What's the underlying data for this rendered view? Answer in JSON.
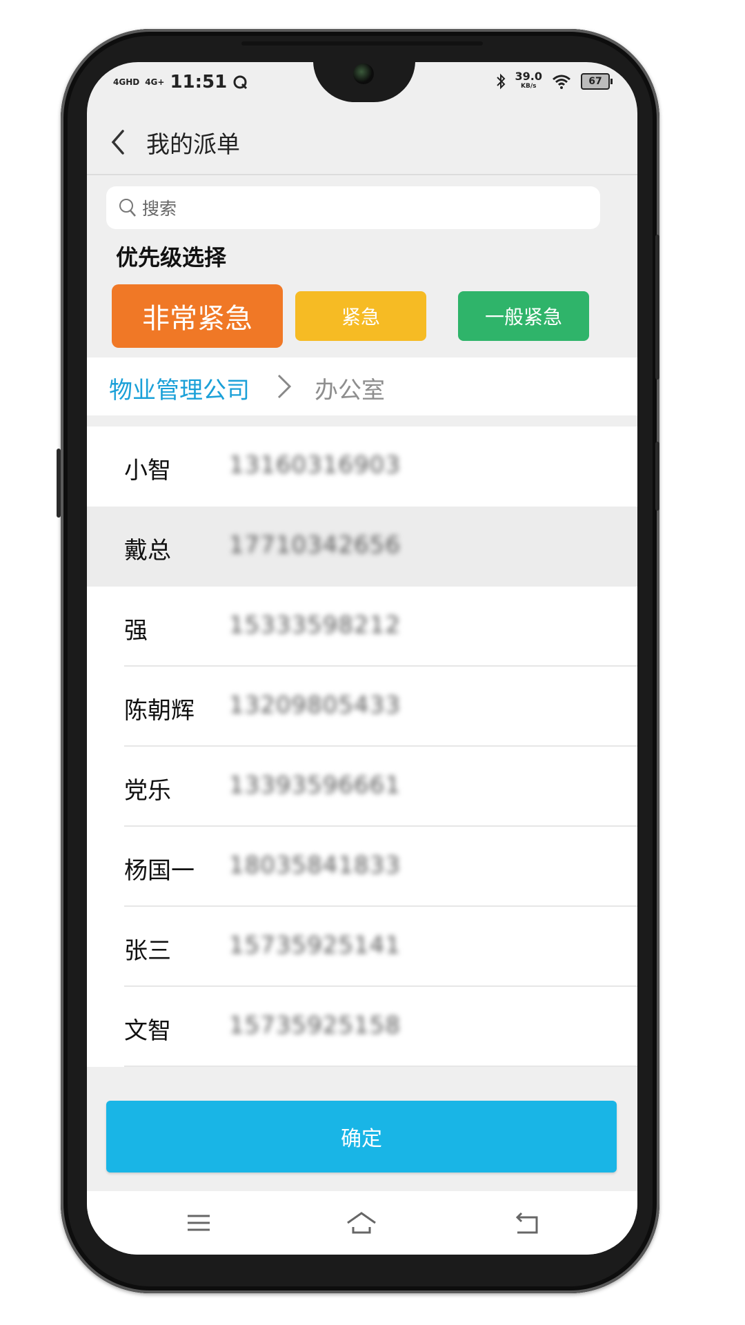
{
  "status_bar": {
    "network_1": "4GHD",
    "network_2": "4G+",
    "time": "11:51",
    "speed_value": "39.0",
    "speed_unit": "KB/s",
    "battery": "67"
  },
  "header": {
    "title": "我的派单"
  },
  "search": {
    "placeholder": "搜索"
  },
  "priority": {
    "label": "优先级选择",
    "options": [
      "非常紧急",
      "紧急",
      "一般紧急"
    ],
    "selected": "非常紧急",
    "colors": {
      "very_urgent": "#f07826",
      "urgent": "#f6bb24",
      "normal": "#2fb46a"
    }
  },
  "breadcrumb": {
    "company": "物业管理公司",
    "department": "办公室"
  },
  "contacts": [
    {
      "name": "小智",
      "phone": "13160316903"
    },
    {
      "name": "戴总",
      "phone": "17710342656"
    },
    {
      "name": "强",
      "phone": "15333598212"
    },
    {
      "name": "陈朝辉",
      "phone": "13209805433"
    },
    {
      "name": "党乐",
      "phone": "13393596661"
    },
    {
      "name": "杨国一",
      "phone": "18035841833"
    },
    {
      "name": "张三",
      "phone": "15735925141"
    },
    {
      "name": "文智",
      "phone": "15735925158"
    }
  ],
  "selected_contact": "戴总",
  "confirm_button": "确定",
  "nav_icons": [
    "menu-icon",
    "home-icon",
    "back-icon"
  ]
}
